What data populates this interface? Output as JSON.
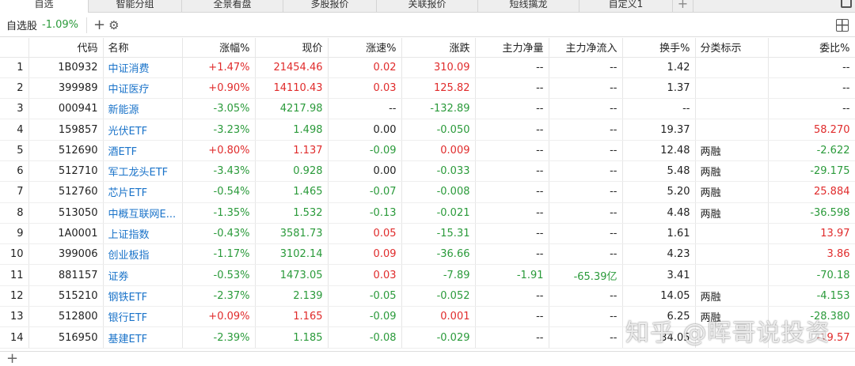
{
  "tabs": [
    {
      "label": "自选",
      "active": true
    },
    {
      "label": "智能分组",
      "active": false
    },
    {
      "label": "全景看盘",
      "active": false
    },
    {
      "label": "多股报价",
      "active": false
    },
    {
      "label": "关联报价",
      "active": false
    },
    {
      "label": "短线擒龙",
      "active": false
    },
    {
      "label": "自定义1",
      "active": false
    }
  ],
  "tab_add_label": "+",
  "toolbar": {
    "group_name": "自选股",
    "group_change": "-1.09%",
    "add_label": "+",
    "settings_label": "⚙"
  },
  "columns": [
    "",
    "代码",
    "名称",
    "涨幅%",
    "现价",
    "涨速%",
    "涨跌",
    "主力净量",
    "主力净流入",
    "换手%",
    "分类标示",
    "委比%"
  ],
  "rows": [
    {
      "idx": "1",
      "code": "1B0932",
      "name": "中证消费",
      "pct": "+1.47%",
      "price": "21454.46",
      "speed": "0.02",
      "change": "310.09",
      "net_vol": "--",
      "net_flow": "--",
      "turnover": "1.42",
      "tag": "",
      "ratio": "--",
      "dir": "up",
      "speed_dir": "up",
      "ratio_dir": "flat"
    },
    {
      "idx": "2",
      "code": "399989",
      "name": "中证医疗",
      "pct": "+0.90%",
      "price": "14110.43",
      "speed": "0.03",
      "change": "125.82",
      "net_vol": "--",
      "net_flow": "--",
      "turnover": "1.37",
      "tag": "",
      "ratio": "--",
      "dir": "up",
      "speed_dir": "up",
      "ratio_dir": "flat"
    },
    {
      "idx": "3",
      "code": "000941",
      "name": "新能源",
      "pct": "-3.05%",
      "price": "4217.98",
      "speed": "--",
      "change": "-132.89",
      "net_vol": "--",
      "net_flow": "--",
      "turnover": "--",
      "tag": "",
      "ratio": "--",
      "dir": "down",
      "speed_dir": "flat",
      "ratio_dir": "flat"
    },
    {
      "idx": "4",
      "code": "159857",
      "name": "光伏ETF",
      "pct": "-3.23%",
      "price": "1.498",
      "speed": "0.00",
      "change": "-0.050",
      "net_vol": "--",
      "net_flow": "--",
      "turnover": "19.37",
      "tag": "",
      "ratio": "58.270",
      "dir": "down",
      "speed_dir": "flat",
      "ratio_dir": "up"
    },
    {
      "idx": "5",
      "code": "512690",
      "name": "酒ETF",
      "pct": "+0.80%",
      "price": "1.137",
      "speed": "-0.09",
      "change": "0.009",
      "net_vol": "--",
      "net_flow": "--",
      "turnover": "12.48",
      "tag": "两融",
      "ratio": "-2.622",
      "dir": "up",
      "speed_dir": "down",
      "ratio_dir": "down"
    },
    {
      "idx": "6",
      "code": "512710",
      "name": "军工龙头ETF",
      "pct": "-3.43%",
      "price": "0.928",
      "speed": "0.00",
      "change": "-0.033",
      "net_vol": "--",
      "net_flow": "--",
      "turnover": "5.48",
      "tag": "两融",
      "ratio": "-29.175",
      "dir": "down",
      "speed_dir": "flat",
      "ratio_dir": "down"
    },
    {
      "idx": "7",
      "code": "512760",
      "name": "芯片ETF",
      "pct": "-0.54%",
      "price": "1.465",
      "speed": "-0.07",
      "change": "-0.008",
      "net_vol": "--",
      "net_flow": "--",
      "turnover": "5.20",
      "tag": "两融",
      "ratio": "25.884",
      "dir": "down",
      "speed_dir": "down",
      "ratio_dir": "up"
    },
    {
      "idx": "8",
      "code": "513050",
      "name": "中概互联网E...",
      "pct": "-1.35%",
      "price": "1.532",
      "speed": "-0.13",
      "change": "-0.021",
      "net_vol": "--",
      "net_flow": "--",
      "turnover": "4.48",
      "tag": "两融",
      "ratio": "-36.598",
      "dir": "down",
      "speed_dir": "down",
      "ratio_dir": "down"
    },
    {
      "idx": "9",
      "code": "1A0001",
      "name": "上证指数",
      "pct": "-0.43%",
      "price": "3581.73",
      "speed": "0.05",
      "change": "-15.31",
      "net_vol": "--",
      "net_flow": "--",
      "turnover": "1.61",
      "tag": "",
      "ratio": "13.97",
      "dir": "down",
      "speed_dir": "up",
      "ratio_dir": "up"
    },
    {
      "idx": "10",
      "code": "399006",
      "name": "创业板指",
      "pct": "-1.17%",
      "price": "3102.14",
      "speed": "0.09",
      "change": "-36.66",
      "net_vol": "--",
      "net_flow": "--",
      "turnover": "4.23",
      "tag": "",
      "ratio": "3.86",
      "dir": "down",
      "speed_dir": "up",
      "ratio_dir": "up"
    },
    {
      "idx": "11",
      "code": "881157",
      "name": "证券",
      "pct": "-0.53%",
      "price": "1473.05",
      "speed": "0.03",
      "change": "-7.89",
      "net_vol": "-1.91",
      "net_flow": "-65.39亿",
      "turnover": "3.41",
      "tag": "",
      "ratio": "-70.18",
      "dir": "down",
      "speed_dir": "up",
      "ratio_dir": "down",
      "flow_dir": "down"
    },
    {
      "idx": "12",
      "code": "515210",
      "name": "钢铁ETF",
      "pct": "-2.37%",
      "price": "2.139",
      "speed": "-0.05",
      "change": "-0.052",
      "net_vol": "--",
      "net_flow": "--",
      "turnover": "14.05",
      "tag": "两融",
      "ratio": "-4.153",
      "dir": "down",
      "speed_dir": "down",
      "ratio_dir": "down"
    },
    {
      "idx": "13",
      "code": "512800",
      "name": "银行ETF",
      "pct": "+0.09%",
      "price": "1.165",
      "speed": "-0.09",
      "change": "0.001",
      "net_vol": "--",
      "net_flow": "--",
      "turnover": "6.25",
      "tag": "两融",
      "ratio": "-28.380",
      "dir": "up",
      "speed_dir": "down",
      "ratio_dir": "down"
    },
    {
      "idx": "14",
      "code": "516950",
      "name": "基建ETF",
      "pct": "-2.39%",
      "price": "1.185",
      "speed": "-0.08",
      "change": "-0.029",
      "net_vol": "--",
      "net_flow": "--",
      "turnover": "34.05",
      "tag": "",
      "ratio": "-19.57",
      "dir": "down",
      "speed_dir": "down",
      "ratio_dir": "up"
    }
  ],
  "footer_add_label": "+",
  "watermark": "知乎 @晖哥说投资",
  "colors": {
    "up": "#e02b2b",
    "down": "#2a9a3a",
    "name": "#1a73c9"
  },
  "icons": [
    "add-icon",
    "gear-icon",
    "grid-layout-icon",
    "window-icon"
  ]
}
